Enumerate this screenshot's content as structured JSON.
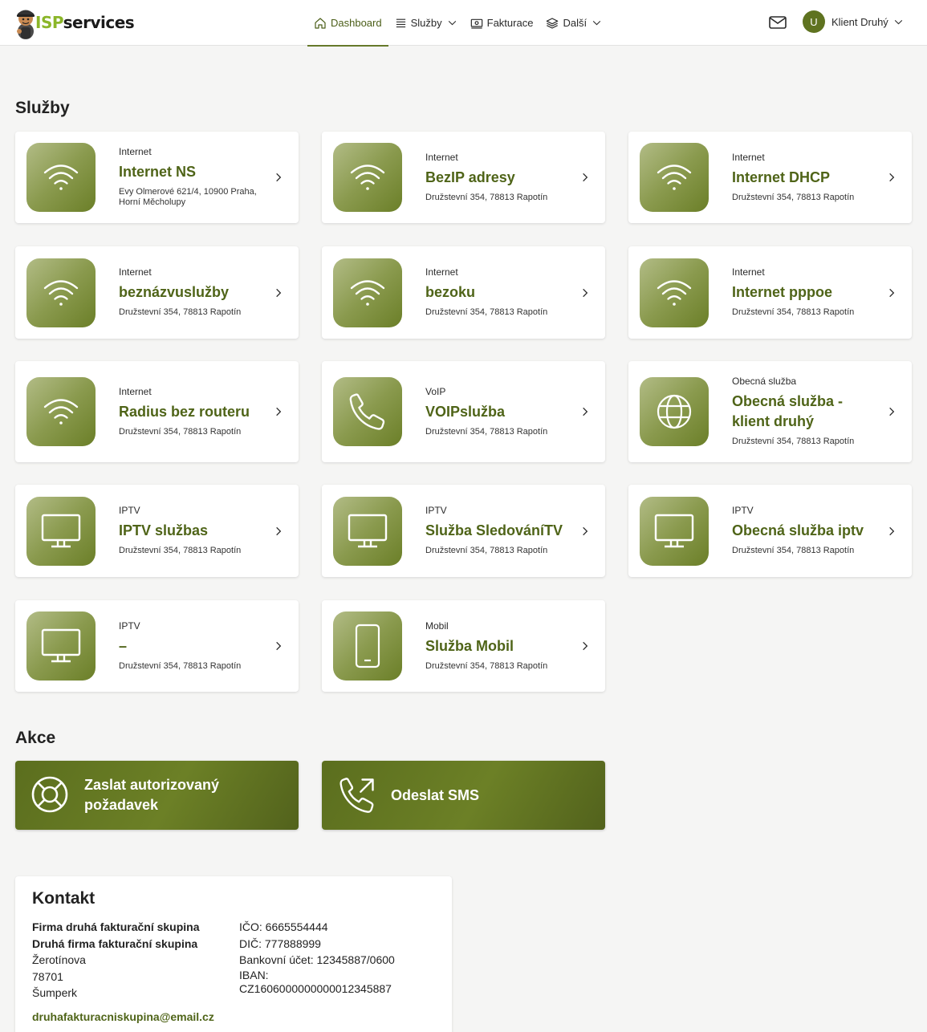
{
  "header": {
    "logo": {
      "isp": "ISP",
      "services": "services"
    },
    "nav": [
      {
        "label": "Dashboard",
        "icon": "home-icon",
        "active": true
      },
      {
        "label": "Služby",
        "icon": "list-icon",
        "dropdown": true
      },
      {
        "label": "Fakturace",
        "icon": "billing-icon"
      },
      {
        "label": "Další",
        "icon": "layers-icon",
        "dropdown": true
      }
    ],
    "user": {
      "initial": "U",
      "name": "Klient Druhý"
    }
  },
  "services_title": "Služby",
  "services": [
    {
      "category": "Internet",
      "name": "Internet NS",
      "address": "Evy Olmerové 621/4, 10900 Praha, Horní Měcholupy",
      "icon": "wifi-icon"
    },
    {
      "category": "Internet",
      "name": "BezIP adresy",
      "address": "Družstevní 354, 78813 Rapotín",
      "icon": "wifi-icon"
    },
    {
      "category": "Internet",
      "name": "Internet DHCP",
      "address": "Družstevní 354, 78813 Rapotín",
      "icon": "wifi-icon"
    },
    {
      "category": "Internet",
      "name": "beznázvuslužby",
      "address": "Družstevní 354, 78813 Rapotín",
      "icon": "wifi-icon"
    },
    {
      "category": "Internet",
      "name": "bezoku",
      "address": "Družstevní 354, 78813 Rapotín",
      "icon": "wifi-icon"
    },
    {
      "category": "Internet",
      "name": "Internet pppoe",
      "address": "Družstevní 354, 78813 Rapotín",
      "icon": "wifi-icon"
    },
    {
      "category": "Internet",
      "name": "Radius bez routeru",
      "address": "Družstevní 354, 78813 Rapotín",
      "icon": "wifi-icon"
    },
    {
      "category": "VoIP",
      "name": "VOIPslužba",
      "address": "Družstevní 354, 78813 Rapotín",
      "icon": "phone-icon"
    },
    {
      "category": "Obecná služba",
      "name": "Obecná služba - klient druhý",
      "address": "Družstevní 354, 78813 Rapotín",
      "icon": "globe-icon"
    },
    {
      "category": "IPTV",
      "name": "IPTV službas",
      "address": "Družstevní 354, 78813 Rapotín",
      "icon": "monitor-icon"
    },
    {
      "category": "IPTV",
      "name": "Služba SledováníTV",
      "address": "Družstevní 354, 78813 Rapotín",
      "icon": "monitor-icon"
    },
    {
      "category": "IPTV",
      "name": "Obecná služba iptv",
      "address": "Družstevní 354, 78813 Rapotín",
      "icon": "monitor-icon"
    },
    {
      "category": "IPTV",
      "name": "–",
      "address": "Družstevní 354, 78813 Rapotín",
      "icon": "monitor-icon"
    },
    {
      "category": "Mobil",
      "name": "Služba Mobil",
      "address": "Družstevní 354, 78813 Rapotín",
      "icon": "mobile-icon"
    }
  ],
  "actions_title": "Akce",
  "actions": [
    {
      "label": "Zaslat autorizovaný požadavek",
      "icon": "lifebuoy-icon"
    },
    {
      "label": "Odeslat SMS",
      "icon": "phone-outgoing-icon"
    }
  ],
  "contact": {
    "title": "Kontakt",
    "company1": "Firma druhá fakturační skupina",
    "company2": "Druhá firma fakturační skupina",
    "street": "Žerotínova",
    "zip": "78701",
    "city": "Šumperk",
    "ico": "IČO: 6665554444",
    "dic": "DIČ: 777888999",
    "bank": "Bankovní účet: 12345887/0600",
    "iban_label": "IBAN:",
    "iban": "CZ1606000000000012345887",
    "email": "druhafakturacniskupina@email.cz"
  },
  "colors": {
    "accent": "#5f7320",
    "accent_text": "#4f6418",
    "logo_green": "#8bb629"
  }
}
